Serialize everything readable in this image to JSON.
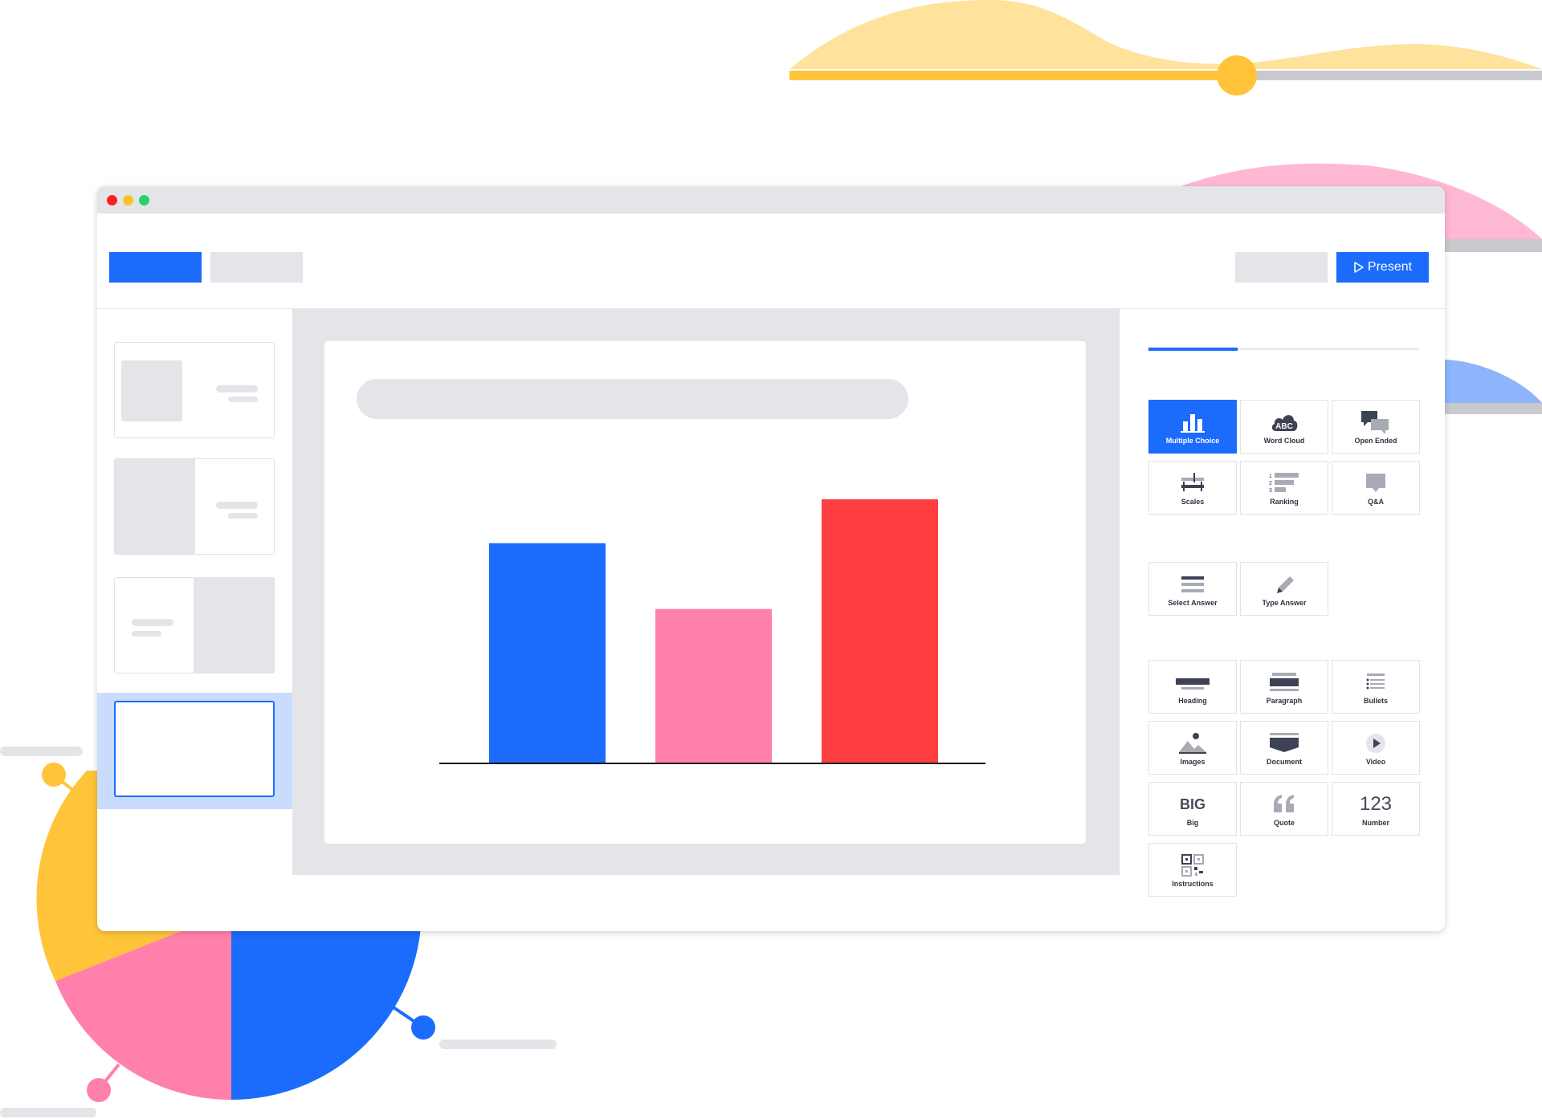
{
  "toolbar": {
    "present_label": "Present"
  },
  "question_types": [
    {
      "label": "Multiple Choice",
      "icon": "bar-chart-icon",
      "active": true
    },
    {
      "label": "Word Cloud",
      "icon": "word-cloud-icon",
      "icon_text": "ABC"
    },
    {
      "label": "Open Ended",
      "icon": "speech-bubbles-icon"
    },
    {
      "label": "Scales",
      "icon": "scales-icon"
    },
    {
      "label": "Ranking",
      "icon": "ranking-icon"
    },
    {
      "label": "Q&A",
      "icon": "qa-bubble-icon"
    }
  ],
  "quiz_types": [
    {
      "label": "Select Answer",
      "icon": "select-answer-icon"
    },
    {
      "label": "Type Answer",
      "icon": "pencil-icon"
    }
  ],
  "content_types": [
    {
      "label": "Heading",
      "icon": "heading-icon"
    },
    {
      "label": "Paragraph",
      "icon": "paragraph-icon"
    },
    {
      "label": "Bullets",
      "icon": "bullets-icon"
    },
    {
      "label": "Images",
      "icon": "image-icon"
    },
    {
      "label": "Document",
      "icon": "document-icon"
    },
    {
      "label": "Video",
      "icon": "video-icon"
    },
    {
      "label": "Big",
      "icon": "big-text-icon",
      "icon_text": "BIG"
    },
    {
      "label": "Quote",
      "icon": "quote-icon"
    },
    {
      "label": "Number",
      "icon": "number-icon",
      "icon_text": "123"
    },
    {
      "label": "Instructions",
      "icon": "qr-code-icon"
    }
  ],
  "colors": {
    "accent": "#1b6cfc",
    "pink": "#ff80aa",
    "red": "#ff3f3f",
    "yellow": "#ffc43a",
    "gray": "#e4e5e8"
  },
  "chart_data": {
    "type": "bar",
    "values": [
      100,
      70,
      120
    ],
    "colors": [
      "#1b6cfc",
      "#ff80aa",
      "#ff3f3f"
    ]
  }
}
